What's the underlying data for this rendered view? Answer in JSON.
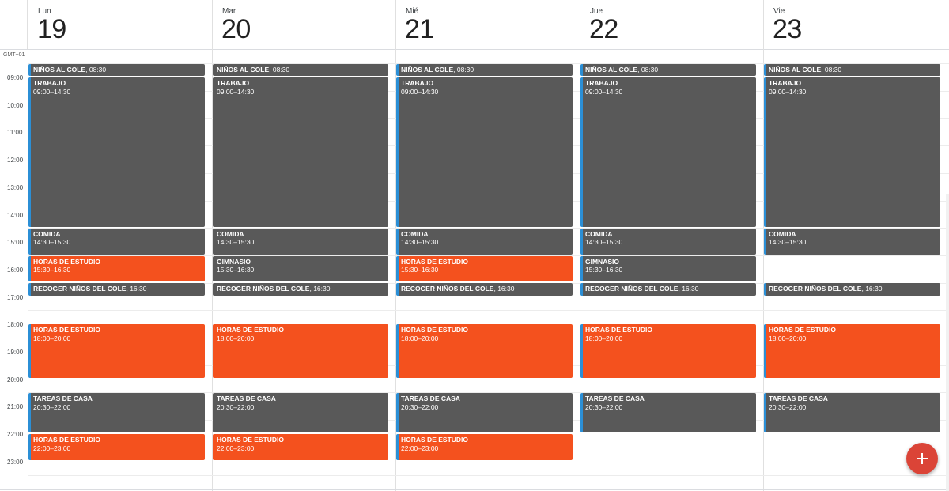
{
  "timezone_label": "GMT+01",
  "hours": [
    "09:00",
    "10:00",
    "11:00",
    "12:00",
    "13:00",
    "14:00",
    "15:00",
    "16:00",
    "17:00",
    "18:00",
    "19:00",
    "20:00",
    "21:00",
    "22:00",
    "23:00"
  ],
  "days": [
    {
      "name": "Lun",
      "number": "19"
    },
    {
      "name": "Mar",
      "number": "20"
    },
    {
      "name": "Mié",
      "number": "21"
    },
    {
      "name": "Jue",
      "number": "22"
    },
    {
      "name": "Vie",
      "number": "23"
    }
  ],
  "colors": {
    "gray_event": "#595959",
    "orange_event": "#f4511e",
    "accent_bar": "#2b8fd6",
    "fab": "#db4437"
  },
  "events": [
    {
      "day": 0,
      "title": "NIÑOS AL COLE",
      "time": "08:30",
      "start": "08:30",
      "end": "09:00",
      "color": "gray",
      "bar": true,
      "inline": true
    },
    {
      "day": 0,
      "title": "TRABAJO",
      "time": "09:00–14:30",
      "start": "09:00",
      "end": "14:30",
      "color": "gray",
      "bar": true
    },
    {
      "day": 0,
      "title": "COMIDA",
      "time": "14:30–15:30",
      "start": "14:30",
      "end": "15:30",
      "color": "gray",
      "bar": true
    },
    {
      "day": 0,
      "title": "HORAS DE ESTUDIO",
      "time": "15:30–16:30",
      "start": "15:30",
      "end": "16:30",
      "color": "orange",
      "bar": true
    },
    {
      "day": 0,
      "title": "RECOGER NIÑOS DEL COLE",
      "time": "16:30",
      "start": "16:30",
      "end": "17:00",
      "color": "gray",
      "bar": true,
      "inline": true
    },
    {
      "day": 0,
      "title": "HORAS DE ESTUDIO",
      "time": "18:00–20:00",
      "start": "18:00",
      "end": "20:00",
      "color": "orange",
      "bar": true
    },
    {
      "day": 0,
      "title": "TAREAS DE CASA",
      "time": "20:30–22:00",
      "start": "20:30",
      "end": "22:00",
      "color": "gray",
      "bar": true
    },
    {
      "day": 0,
      "title": "HORAS DE ESTUDIO",
      "time": "22:00–23:00",
      "start": "22:00",
      "end": "23:00",
      "color": "orange",
      "bar": true
    },
    {
      "day": 1,
      "title": "NIÑOS AL COLE",
      "time": "08:30",
      "start": "08:30",
      "end": "09:00",
      "color": "gray",
      "bar": false,
      "inline": true
    },
    {
      "day": 1,
      "title": "TRABAJO",
      "time": "09:00–14:30",
      "start": "09:00",
      "end": "14:30",
      "color": "gray",
      "bar": false
    },
    {
      "day": 1,
      "title": "COMIDA",
      "time": "14:30–15:30",
      "start": "14:30",
      "end": "15:30",
      "color": "gray",
      "bar": false
    },
    {
      "day": 1,
      "title": "GIMNASIO",
      "time": "15:30–16:30",
      "start": "15:30",
      "end": "16:30",
      "color": "gray",
      "bar": false
    },
    {
      "day": 1,
      "title": "RECOGER NIÑOS DEL COLE",
      "time": "16:30",
      "start": "16:30",
      "end": "17:00",
      "color": "gray",
      "bar": false,
      "inline": true
    },
    {
      "day": 1,
      "title": "HORAS DE ESTUDIO",
      "time": "18:00–20:00",
      "start": "18:00",
      "end": "20:00",
      "color": "orange",
      "bar": false
    },
    {
      "day": 1,
      "title": "TAREAS DE CASA",
      "time": "20:30–22:00",
      "start": "20:30",
      "end": "22:00",
      "color": "gray",
      "bar": false
    },
    {
      "day": 1,
      "title": "HORAS DE ESTUDIO",
      "time": "22:00–23:00",
      "start": "22:00",
      "end": "23:00",
      "color": "orange",
      "bar": false
    },
    {
      "day": 2,
      "title": "NIÑOS AL COLE",
      "time": "08:30",
      "start": "08:30",
      "end": "09:00",
      "color": "gray",
      "bar": true,
      "inline": true
    },
    {
      "day": 2,
      "title": "TRABAJO",
      "time": "09:00–14:30",
      "start": "09:00",
      "end": "14:30",
      "color": "gray",
      "bar": true
    },
    {
      "day": 2,
      "title": "COMIDA",
      "time": "14:30–15:30",
      "start": "14:30",
      "end": "15:30",
      "color": "gray",
      "bar": true
    },
    {
      "day": 2,
      "title": "HORAS DE ESTUDIO",
      "time": "15:30–16:30",
      "start": "15:30",
      "end": "16:30",
      "color": "orange",
      "bar": true
    },
    {
      "day": 2,
      "title": "RECOGER NIÑOS DEL COLE",
      "time": "16:30",
      "start": "16:30",
      "end": "17:00",
      "color": "gray",
      "bar": true,
      "inline": true
    },
    {
      "day": 2,
      "title": "HORAS DE ESTUDIO",
      "time": "18:00–20:00",
      "start": "18:00",
      "end": "20:00",
      "color": "orange",
      "bar": true
    },
    {
      "day": 2,
      "title": "TAREAS DE CASA",
      "time": "20:30–22:00",
      "start": "20:30",
      "end": "22:00",
      "color": "gray",
      "bar": true
    },
    {
      "day": 2,
      "title": "HORAS DE ESTUDIO",
      "time": "22:00–23:00",
      "start": "22:00",
      "end": "23:00",
      "color": "orange",
      "bar": true
    },
    {
      "day": 3,
      "title": "NIÑOS AL COLE",
      "time": "08:30",
      "start": "08:30",
      "end": "09:00",
      "color": "gray",
      "bar": true,
      "inline": true
    },
    {
      "day": 3,
      "title": "TRABAJO",
      "time": "09:00–14:30",
      "start": "09:00",
      "end": "14:30",
      "color": "gray",
      "bar": true
    },
    {
      "day": 3,
      "title": "COMIDA",
      "time": "14:30–15:30",
      "start": "14:30",
      "end": "15:30",
      "color": "gray",
      "bar": true
    },
    {
      "day": 3,
      "title": "GIMNASIO",
      "time": "15:30–16:30",
      "start": "15:30",
      "end": "16:30",
      "color": "gray",
      "bar": true
    },
    {
      "day": 3,
      "title": "RECOGER NIÑOS DEL COLE",
      "time": "16:30",
      "start": "16:30",
      "end": "17:00",
      "color": "gray",
      "bar": true,
      "inline": true
    },
    {
      "day": 3,
      "title": "HORAS DE ESTUDIO",
      "time": "18:00–20:00",
      "start": "18:00",
      "end": "20:00",
      "color": "orange",
      "bar": true
    },
    {
      "day": 3,
      "title": "TAREAS DE CASA",
      "time": "20:30–22:00",
      "start": "20:30",
      "end": "22:00",
      "color": "gray",
      "bar": true
    },
    {
      "day": 4,
      "title": "NIÑOS AL COLE",
      "time": "08:30",
      "start": "08:30",
      "end": "09:00",
      "color": "gray",
      "bar": true,
      "inline": true
    },
    {
      "day": 4,
      "title": "TRABAJO",
      "time": "09:00–14:30",
      "start": "09:00",
      "end": "14:30",
      "color": "gray",
      "bar": true
    },
    {
      "day": 4,
      "title": "COMIDA",
      "time": "14:30–15:30",
      "start": "14:30",
      "end": "15:30",
      "color": "gray",
      "bar": true
    },
    {
      "day": 4,
      "title": "RECOGER NIÑOS DEL COLE",
      "time": "16:30",
      "start": "16:30",
      "end": "17:00",
      "color": "gray",
      "bar": true,
      "inline": true
    },
    {
      "day": 4,
      "title": "HORAS DE ESTUDIO",
      "time": "18:00–20:00",
      "start": "18:00",
      "end": "20:00",
      "color": "orange",
      "bar": true
    },
    {
      "day": 4,
      "title": "TAREAS DE CASA",
      "time": "20:30–22:00",
      "start": "20:30",
      "end": "22:00",
      "color": "gray",
      "bar": true
    }
  ],
  "fab": {
    "icon": "plus-icon"
  }
}
